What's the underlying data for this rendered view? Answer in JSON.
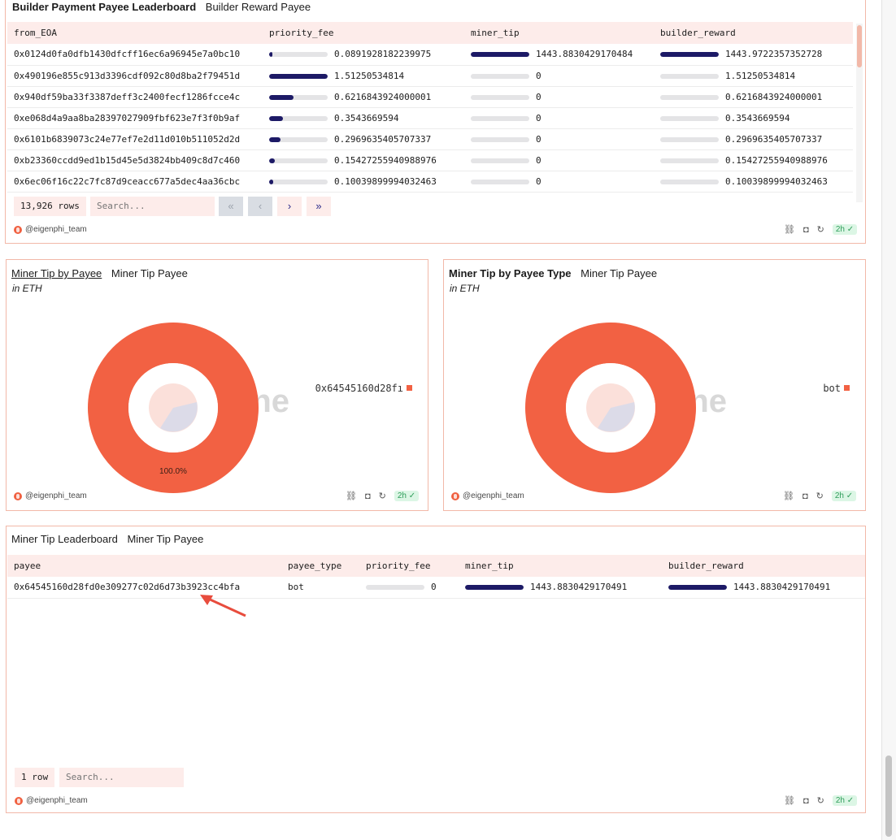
{
  "top_panel": {
    "title": "Builder Payment Payee Leaderboard",
    "subtitle": "Builder Reward Payee",
    "columns": [
      "from_EOA",
      "priority_fee",
      "miner_tip",
      "builder_reward"
    ],
    "rows": [
      {
        "from_EOA": "0x0124d0fa0dfb1430dfcff16ec6a96945e7a0bc10",
        "priority_fee": "0.0891928182239975",
        "priority_fee_level": 0.06,
        "miner_tip": "1443.8830429170484",
        "miner_tip_level": 1.0,
        "builder_reward": "1443.9722357352728",
        "builder_reward_level": 1.0
      },
      {
        "from_EOA": "0x490196e855c913d3396cdf092c80d8ba2f79451d",
        "priority_fee": "1.51250534814",
        "priority_fee_level": 1.0,
        "miner_tip": "0",
        "miner_tip_level": 0,
        "builder_reward": "1.51250534814",
        "builder_reward_level": 0
      },
      {
        "from_EOA": "0x940df59ba33f3387deff3c2400fecf1286fcce4c",
        "priority_fee": "0.6216843924000001",
        "priority_fee_level": 0.41,
        "miner_tip": "0",
        "miner_tip_level": 0,
        "builder_reward": "0.6216843924000001",
        "builder_reward_level": 0
      },
      {
        "from_EOA": "0xe068d4a9aa8ba28397027909fbf623e7f3f0b9af",
        "priority_fee": "0.3543669594",
        "priority_fee_level": 0.23,
        "miner_tip": "0",
        "miner_tip_level": 0,
        "builder_reward": "0.3543669594",
        "builder_reward_level": 0
      },
      {
        "from_EOA": "0x6101b6839073c24e77ef7e2d11d010b511052d2d",
        "priority_fee": "0.2969635405707337",
        "priority_fee_level": 0.2,
        "miner_tip": "0",
        "miner_tip_level": 0,
        "builder_reward": "0.2969635405707337",
        "builder_reward_level": 0
      },
      {
        "from_EOA": "0xb23360ccdd9ed1b15d45e5d3824bb409c8d7c460",
        "priority_fee": "0.15427255940988976",
        "priority_fee_level": 0.1,
        "miner_tip": "0",
        "miner_tip_level": 0,
        "builder_reward": "0.15427255940988976",
        "builder_reward_level": 0
      },
      {
        "from_EOA": "0x6ec06f16c22c7fc87d9ceacc677a5dec4aa36cbc",
        "priority_fee": "0.10039899994032463",
        "priority_fee_level": 0.07,
        "miner_tip": "0",
        "miner_tip_level": 0,
        "builder_reward": "0.10039899994032463",
        "builder_reward_level": 0
      }
    ],
    "row_count": "13,926 rows",
    "search_placeholder": "Search...",
    "pager": [
      "«",
      "‹",
      "›",
      "»"
    ],
    "author": "@eigenphi_team",
    "age": "2h"
  },
  "left_chart": {
    "title": "Miner Tip by Payee",
    "subtitle": "Miner Tip Payee",
    "unit": "in ETH",
    "watermark": "Dune",
    "author": "@eigenphi_team",
    "age": "2h"
  },
  "right_chart": {
    "title": "Miner Tip by Payee Type",
    "subtitle": "Miner Tip Payee",
    "unit": "in ETH",
    "watermark": "Dune",
    "author": "@eigenphi_team",
    "age": "2h"
  },
  "chart_data": [
    {
      "type": "pie",
      "title": "Miner Tip by Payee",
      "subtitle": "Miner Tip Payee",
      "categories": [
        "0x64545160d28fı"
      ],
      "values": [
        100.0
      ],
      "data_labels": [
        "100.0%"
      ],
      "legend": "right",
      "colors": [
        "#f26143"
      ]
    },
    {
      "type": "pie",
      "title": "Miner Tip by Payee Type",
      "subtitle": "Miner Tip Payee",
      "categories": [
        "bot"
      ],
      "values": [
        100.0
      ],
      "legend": "right",
      "colors": [
        "#f26143"
      ]
    }
  ],
  "bottom_panel": {
    "title": "Miner Tip Leaderboard",
    "subtitle": "Miner Tip Payee",
    "columns": [
      "payee",
      "payee_type",
      "priority_fee",
      "miner_tip",
      "builder_reward"
    ],
    "rows": [
      {
        "payee": "0x64545160d28fd0e309277c02d6d73b3923cc4bfa",
        "payee_type": "bot",
        "priority_fee": "0",
        "priority_fee_level": 0,
        "miner_tip": "1443.8830429170491",
        "miner_tip_level": 1.0,
        "builder_reward": "1443.8830429170491",
        "builder_reward_level": 1.0
      }
    ],
    "row_count": "1 row",
    "search_placeholder": "Search...",
    "author": "@eigenphi_team",
    "age": "2h"
  },
  "colors": {
    "accent": "#f26143",
    "bar": "#1d1a66",
    "header_bg": "#fdecea",
    "border": "#f2b8a8",
    "arrow": "#e84c3d"
  }
}
